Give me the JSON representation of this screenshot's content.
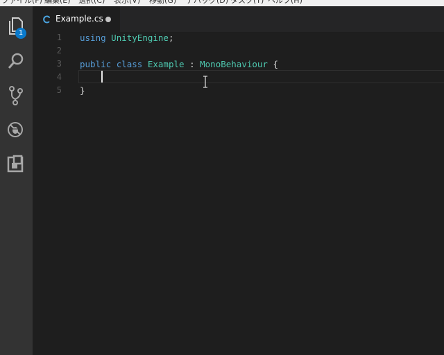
{
  "menubar": {
    "items": [
      "ファイル(F)",
      "編集(E)",
      "選択(C)",
      "表示(V)",
      "移動(G)",
      "デバッグ(D)",
      "タスク(T)",
      "ヘルプ(H)"
    ]
  },
  "activitybar": {
    "explorer_badge": "1",
    "icons": [
      "files-icon",
      "search-icon",
      "source-control-icon",
      "debug-icon",
      "extensions-icon"
    ]
  },
  "tab": {
    "label": "Example.cs",
    "icon": "csharp-icon",
    "dirty": true
  },
  "editor": {
    "lines": [
      {
        "number": "1",
        "tokens": [
          {
            "t": "kw",
            "v": "using"
          },
          {
            "t": "plain",
            "v": " "
          },
          {
            "t": "type",
            "v": "UnityEngine"
          },
          {
            "t": "plain",
            "v": ";"
          }
        ]
      },
      {
        "number": "2",
        "tokens": []
      },
      {
        "number": "3",
        "tokens": [
          {
            "t": "kw",
            "v": "public"
          },
          {
            "t": "plain",
            "v": " "
          },
          {
            "t": "kw",
            "v": "class"
          },
          {
            "t": "plain",
            "v": " "
          },
          {
            "t": "type",
            "v": "Example"
          },
          {
            "t": "plain",
            "v": " : "
          },
          {
            "t": "type",
            "v": "MonoBehaviour"
          },
          {
            "t": "plain",
            "v": " {"
          }
        ]
      },
      {
        "number": "4",
        "tokens": [
          {
            "t": "plain",
            "v": "    "
          }
        ]
      },
      {
        "number": "5",
        "tokens": [
          {
            "t": "plain",
            "v": "}"
          }
        ]
      }
    ]
  },
  "colors": {
    "keyword": "#569cd6",
    "type": "#4ec9b0",
    "badge": "#0a7acc"
  }
}
